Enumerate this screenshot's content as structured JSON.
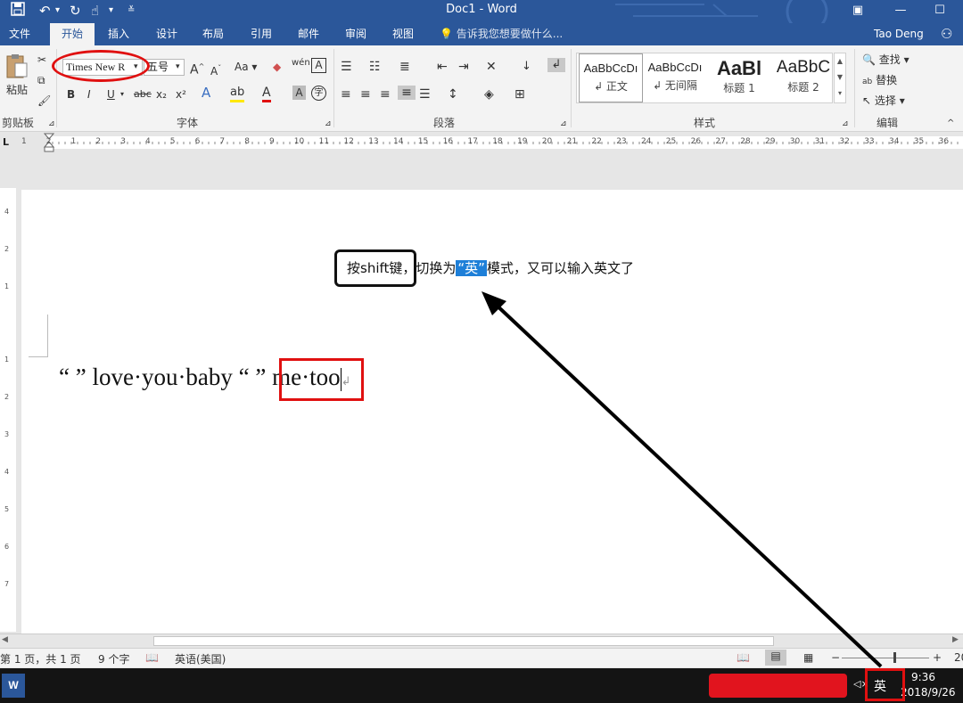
{
  "window": {
    "title": "Doc1 - Word",
    "icons": [
      "save-icon",
      "undo-icon",
      "redo-icon",
      "touch-mode-icon",
      "customize-icon"
    ]
  },
  "tabs": [
    "文件",
    "开始",
    "插入",
    "设计",
    "布局",
    "引用",
    "邮件",
    "审阅",
    "视图"
  ],
  "tell_me": "告诉我您想要做什么...",
  "user": "Tao Deng",
  "ribbon": {
    "clipboard": {
      "paste": "粘贴",
      "label": "剪贴板"
    },
    "font": {
      "family": "Times New R",
      "size": "五号",
      "label": "字体",
      "change_case": "Aa",
      "phonetic": "wén",
      "bold": "B",
      "italic": "I",
      "underline": "U",
      "strike": "abc",
      "sub": "x₂",
      "sup": "x²"
    },
    "paragraph": {
      "label": "段落"
    },
    "styles": {
      "label": "样式",
      "items": [
        {
          "preview": "AaBbCcDı",
          "name": "↲ 正文"
        },
        {
          "preview": "AaBbCcDı",
          "name": "↲ 无间隔"
        },
        {
          "preview": "AaBl",
          "name": "标题 1"
        },
        {
          "preview": "AaBbC",
          "name": "标题 2"
        }
      ]
    },
    "editing": {
      "find": "查找",
      "replace": "替换",
      "select": "选择",
      "label": "编辑"
    }
  },
  "ruler": {
    "numbers": [
      "1",
      "2",
      "1",
      "2",
      "3",
      "4",
      "5",
      "6",
      "7",
      "8",
      "9",
      "10",
      "11",
      "12",
      "13",
      "14",
      "15",
      "16",
      "17",
      "18",
      "19",
      "20",
      "21",
      "22",
      "23",
      "24",
      "25",
      "26",
      "27",
      "28",
      "29",
      "30",
      "31",
      "32",
      "33",
      "34",
      "35",
      "36"
    ],
    "vertical": [
      "4",
      "2",
      "1",
      "1",
      "2",
      "3",
      "4",
      "5",
      "6",
      "7"
    ]
  },
  "document": {
    "line1_before": "按shift键，切换为",
    "line1_highlight": "“英”",
    "line1_after": "模式，又可以输入英文了",
    "line2_quotes1": "“ ”",
    "line2_text": "love·you·baby",
    "line2_quotes2": "“ ”",
    "line2_end": "me·too",
    "para_mark": "↲"
  },
  "status": {
    "page": "第 1 页，共 1 页",
    "words": "9 个字",
    "language": "英语(美国)",
    "zoom_minus": "−",
    "zoom_plus": "+",
    "zoom": "20"
  },
  "taskbar": {
    "ime": "英",
    "time": "9:36",
    "date": "2018/9/26",
    "speaker": "◁×"
  }
}
